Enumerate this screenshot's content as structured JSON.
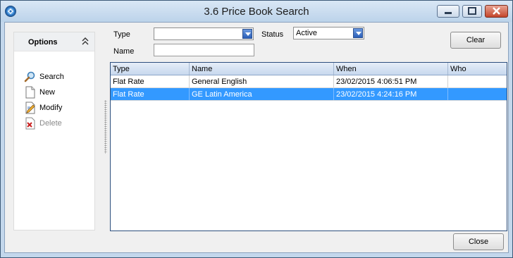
{
  "window": {
    "title": "3.6 Price Book Search"
  },
  "options": {
    "title": "Options",
    "items": [
      {
        "label": "Search",
        "icon": "magnifier-icon",
        "enabled": true
      },
      {
        "label": "New",
        "icon": "new-document-icon",
        "enabled": true
      },
      {
        "label": "Modify",
        "icon": "edit-document-icon",
        "enabled": true
      },
      {
        "label": "Delete",
        "icon": "delete-document-icon",
        "enabled": false
      }
    ]
  },
  "filters": {
    "type_label": "Type",
    "type_value": "",
    "status_label": "Status",
    "status_value": "Active",
    "name_label": "Name",
    "name_value": ""
  },
  "buttons": {
    "clear": "Clear",
    "close": "Close"
  },
  "grid": {
    "columns": [
      "Type",
      "Name",
      "When",
      "Who"
    ],
    "rows": [
      {
        "type": "Flat Rate",
        "name": "General English",
        "when": "23/02/2015 4:06:51 PM",
        "who": "",
        "selected": false
      },
      {
        "type": "Flat Rate",
        "name": "GE Latin America",
        "when": "23/02/2015 4:24:16 PM",
        "who": "",
        "selected": true
      }
    ]
  },
  "colors": {
    "selection": "#3399ff",
    "grid_border": "#2d4f7d",
    "title_bar": "#c3d7ec"
  }
}
